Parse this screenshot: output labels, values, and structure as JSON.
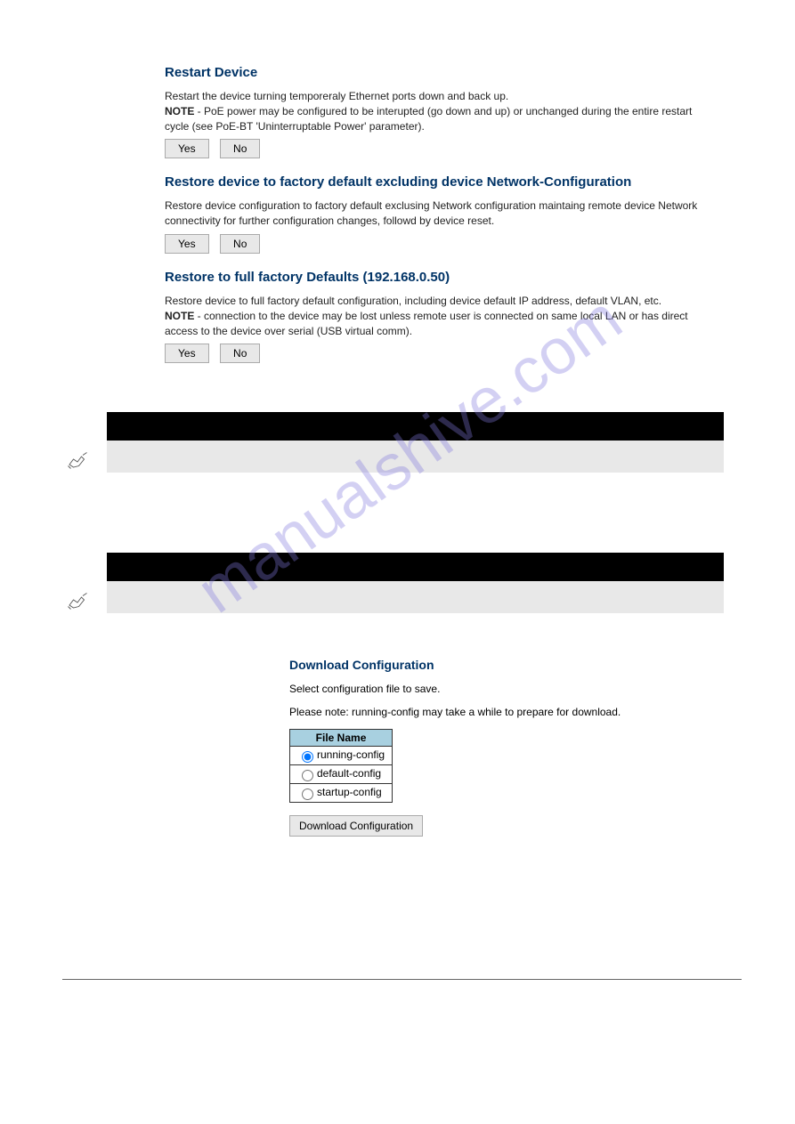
{
  "watermark": "manualshive.com",
  "screenshot": {
    "restart": {
      "title": "Restart Device",
      "line1": "Restart the device turning temporeraly Ethernet ports down and back up.",
      "note_label": "NOTE",
      "note_text": " - PoE power may be configured to be interupted (go down and up) or unchanged during the entire restart cycle (see PoE-BT 'Uninterruptable Power' parameter).",
      "yes": "Yes",
      "no": "No"
    },
    "restore_partial": {
      "title": "Restore device to factory default excluding device Network-Configuration",
      "text": "Restore device configuration to factory default exclusing Network configuration maintaing remote device Network connectivity for further configuration changes, followd by device reset.",
      "yes": "Yes",
      "no": "No"
    },
    "restore_full": {
      "title": "Restore to full factory Defaults (192.168.0.50)",
      "line1": "Restore device to full factory default configuration, including device default IP address, default VLAN, etc.",
      "note_label": "NOTE",
      "note_text": " - connection to the device may be lost unless remote user is connected on same local LAN or has direct access to the device over serial (USB virtual comm).",
      "yes": "Yes",
      "no": "No"
    }
  },
  "download": {
    "title": "Download Configuration",
    "select_text": "Select configuration file to save.",
    "note_text": "Please note: running-config may take a while to prepare for download.",
    "table_header": "File Name",
    "options": [
      "running-config",
      "default-config",
      "startup-config"
    ],
    "button": "Download Configuration"
  }
}
